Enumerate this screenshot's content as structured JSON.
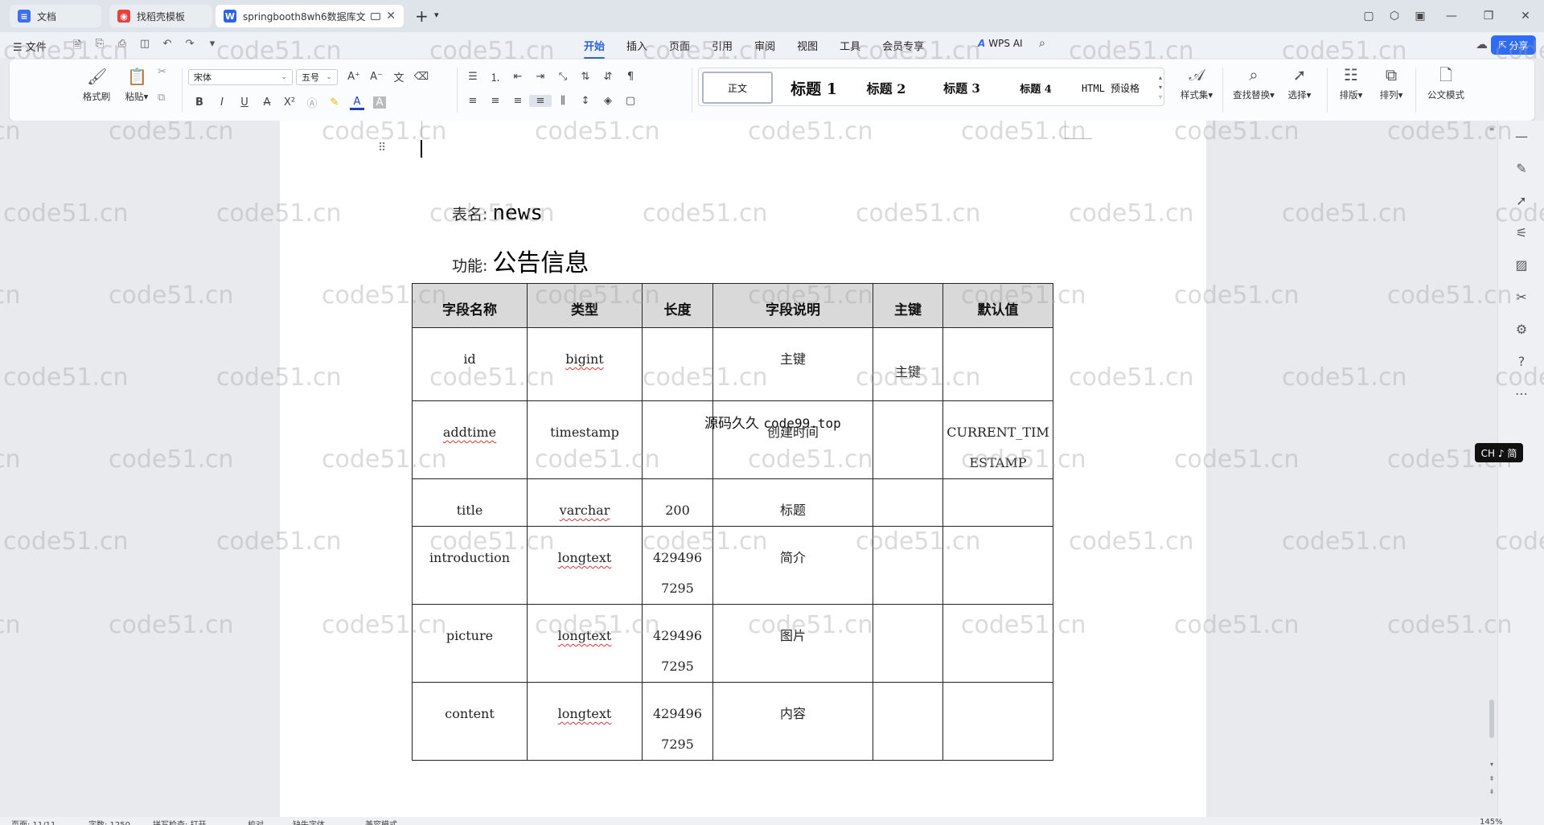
{
  "tabs": [
    {
      "label": "文档",
      "icon": "doc-icon"
    },
    {
      "label": "找稻壳模板",
      "icon": "docer-icon"
    },
    {
      "label": "springbooth8wh6数据库文",
      "icon": "wps-writer-icon"
    }
  ],
  "menu": {
    "file_label": "文件",
    "tabs": [
      "开始",
      "插入",
      "页面",
      "引用",
      "审阅",
      "视图",
      "工具",
      "会员专享"
    ],
    "active_tab": "开始",
    "wps_ai": "WPS AI",
    "share": "分享"
  },
  "ribbon": {
    "format_painter": "格式刷",
    "paste": "粘贴",
    "font_name": "宋体",
    "font_size": "五号",
    "styles": [
      "正文",
      "标题 1",
      "标题 2",
      "标题 3",
      "标题 4",
      "HTML 预设格"
    ],
    "style_set": "样式集",
    "find_replace": "查找替换",
    "select": "选择",
    "layout": "排版",
    "arrange": "排列",
    "official_mode": "公文模式",
    "font_buttons": [
      "B",
      "I",
      "U",
      "A",
      "X²",
      "A",
      "A"
    ]
  },
  "document": {
    "table_name_label": "表名:",
    "table_name": "news",
    "function_label": "功能:",
    "function": "公告信息",
    "stamp": "源码久久",
    "stamp_url": "code99.top",
    "headers": [
      "字段名称",
      "类型",
      "长度",
      "字段说明",
      "主键",
      "默认值"
    ],
    "rows": [
      {
        "name": "id",
        "type": "bigint",
        "length": "",
        "desc": "主键",
        "pk": "主键",
        "default": ""
      },
      {
        "name": "addtime",
        "type": "timestamp",
        "length": "",
        "desc": "创建时间",
        "pk": "",
        "default_1": "CURRENT_TIM",
        "default_2": "ESTAMP"
      },
      {
        "name": "title",
        "type": "varchar",
        "length": "200",
        "desc": "标题",
        "pk": "",
        "default": ""
      },
      {
        "name": "introduction",
        "type": "longtext",
        "length_1": "429496",
        "length_2": "7295",
        "desc": "简介",
        "pk": "",
        "default": ""
      },
      {
        "name": "picture",
        "type": "longtext",
        "length_1": "429496",
        "length_2": "7295",
        "desc": "图片",
        "pk": "",
        "default": ""
      },
      {
        "name": "content",
        "type": "longtext",
        "length_1": "429496",
        "length_2": "7295",
        "desc": "内容",
        "pk": "",
        "default": ""
      }
    ]
  },
  "watermark": "code51.cn",
  "ime_badge": "CH ♪ 简",
  "status": {
    "page": "页面: 11/11",
    "words": "字数: 1250",
    "spell": "拼写检查: 打开",
    "proof": "校对",
    "font_missing": "缺失字体",
    "compat": "兼容模式",
    "zoom": "145%"
  },
  "colors": {
    "accent": "#2b62e8",
    "share_bg": "#2f6cf6",
    "header_fill": "#d9d9d9"
  }
}
